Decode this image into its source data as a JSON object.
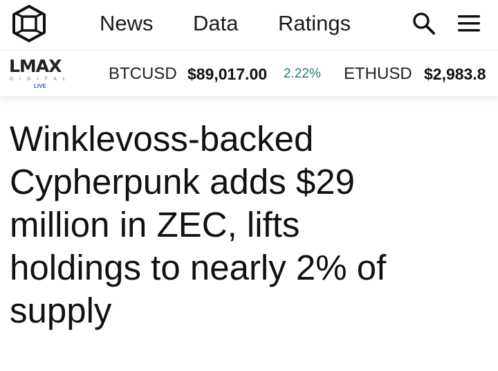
{
  "header": {
    "nav": [
      {
        "label": "News"
      },
      {
        "label": "Data"
      },
      {
        "label": "Ratings"
      }
    ],
    "icons": [
      "logo-icon",
      "search-icon",
      "menu-icon"
    ]
  },
  "ticker": {
    "sponsor": {
      "word": "LMAX",
      "sub": "DIGITAL",
      "live": "LIVE"
    },
    "items": [
      {
        "symbol": "BTCUSD",
        "price": "$89,017.00",
        "change": "2.22%"
      },
      {
        "symbol": "ETHUSD",
        "price": "$2,983.8"
      }
    ],
    "change_color": "#1d7f74"
  },
  "article": {
    "headline_lines": [
      "Winklevoss-backed",
      "Cypherpunk adds $29",
      "million in ZEC, lifts",
      "holdings to nearly 2% of",
      "supply"
    ]
  }
}
